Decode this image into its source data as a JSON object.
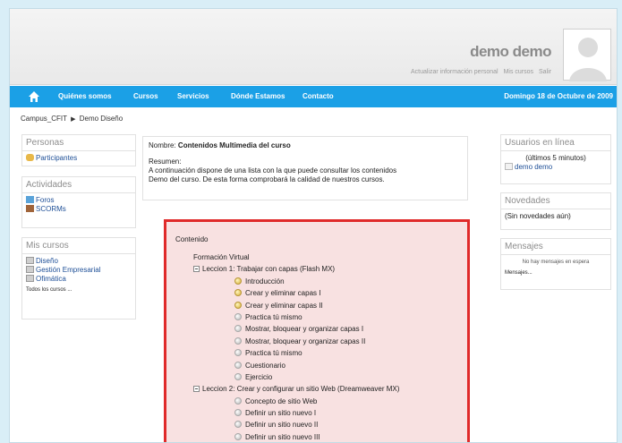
{
  "header": {
    "user_name": "demo demo",
    "links": [
      "Actualizar información personal",
      "Mis cursos",
      "Salir"
    ]
  },
  "nav": {
    "items": [
      "Quiénes somos",
      "Cursos",
      "Servicios",
      "Dónde Estamos",
      "Contacto"
    ],
    "date": "Domingo 18 de Octubre de 2009"
  },
  "breadcrumb": {
    "root": "Campus_CFIT",
    "current": "Demo Diseño"
  },
  "left": {
    "personas_title": "Personas",
    "participantes": "Participantes",
    "actividades_title": "Actividades",
    "foros": "Foros",
    "scorms": "SCORMs",
    "mis_cursos_title": "Mis cursos",
    "cursos": [
      "Diseño",
      "Gestión Empresarial",
      "Ofimática"
    ],
    "todos": "Todos los cursos ..."
  },
  "summary": {
    "nombre_label": "Nombre:",
    "nombre_value": "Contenidos Multimedia del curso",
    "resumen_label": "Resumen:",
    "line1": "A continuación dispone de una lista con la que puede consultar los contenidos",
    "line2": "Demo del curso. De esta forma comprobará la calidad de nuestros cursos."
  },
  "content": {
    "title": "Contenido",
    "root": "Formación Virtual",
    "lesson1": "Leccion 1: Trabajar con capas (Flash MX)",
    "lesson1_items": [
      "Introducción",
      "Crear y eliminar capas I",
      "Crear y eliminar capas II",
      "Practica tú mismo",
      "Mostrar, bloquear y organizar capas I",
      "Mostrar, bloquear y organizar capas II",
      "Practica tú mismo",
      "Cuestionario",
      "Ejercicio"
    ],
    "lesson2": "Leccion 2: Crear y configurar un sitio Web (Dreamweaver MX)",
    "lesson2_items": [
      "Concepto de sitio Web",
      "Definir un sitio nuevo I",
      "Definir un sitio nuevo II",
      "Definir un sitio nuevo III"
    ]
  },
  "right": {
    "usuarios_title": "Usuarios en línea",
    "ultimos": "(últimos 5 minutos)",
    "user": "demo demo",
    "novedades_title": "Novedades",
    "sin_novedades": "(Sin novedades aún)",
    "mensajes_title": "Mensajes",
    "no_mensajes": "No hay mensajes en espera",
    "mensajes_link": "Mensajes..."
  }
}
